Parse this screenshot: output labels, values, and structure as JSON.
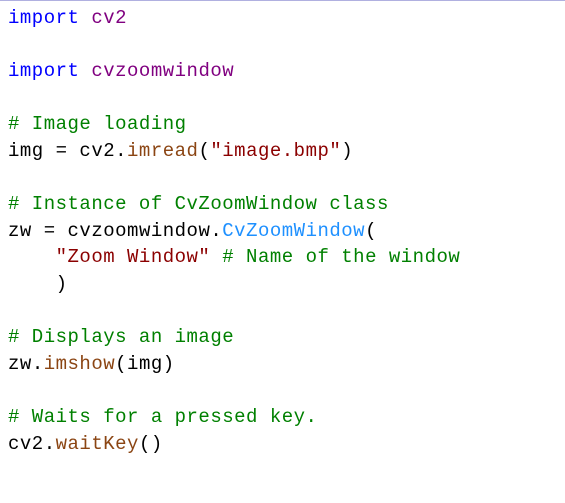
{
  "code": {
    "l1_import": "import",
    "l1_cv2": "cv2",
    "l3_import": "import",
    "l3_cvzoom": "cvzoomwindow",
    "l5_comment": "# Image loading",
    "l6_img": "img ",
    "l6_eq": "=",
    "l6_cv2": " cv2",
    "l6_dot": ".",
    "l6_imread": "imread",
    "l6_p1": "(",
    "l6_str": "\"image.bmp\"",
    "l6_p2": ")",
    "l8_comment": "# Instance of CvZoomWindow class",
    "l9_zw": "zw ",
    "l9_eq": "=",
    "l9_mod": " cvzoomwindow",
    "l9_dot": ".",
    "l9_cls": "CvZoomWindow",
    "l9_p1": "(",
    "l10_indent": "    ",
    "l10_str": "\"Zoom Window\"",
    "l10_sp": " ",
    "l10_comment": "# Name of the window",
    "l11_indent": "    ",
    "l11_p2": ")",
    "l13_comment": "# Displays an image",
    "l14_zw": "zw",
    "l14_dot": ".",
    "l14_imshow": "imshow",
    "l14_p1": "(",
    "l14_img": "img",
    "l14_p2": ")",
    "l16_comment": "# Waits for a pressed key.",
    "l17_cv2": "cv2",
    "l17_dot": ".",
    "l17_waitkey": "waitKey",
    "l17_p1": "(",
    "l17_p2": ")"
  }
}
